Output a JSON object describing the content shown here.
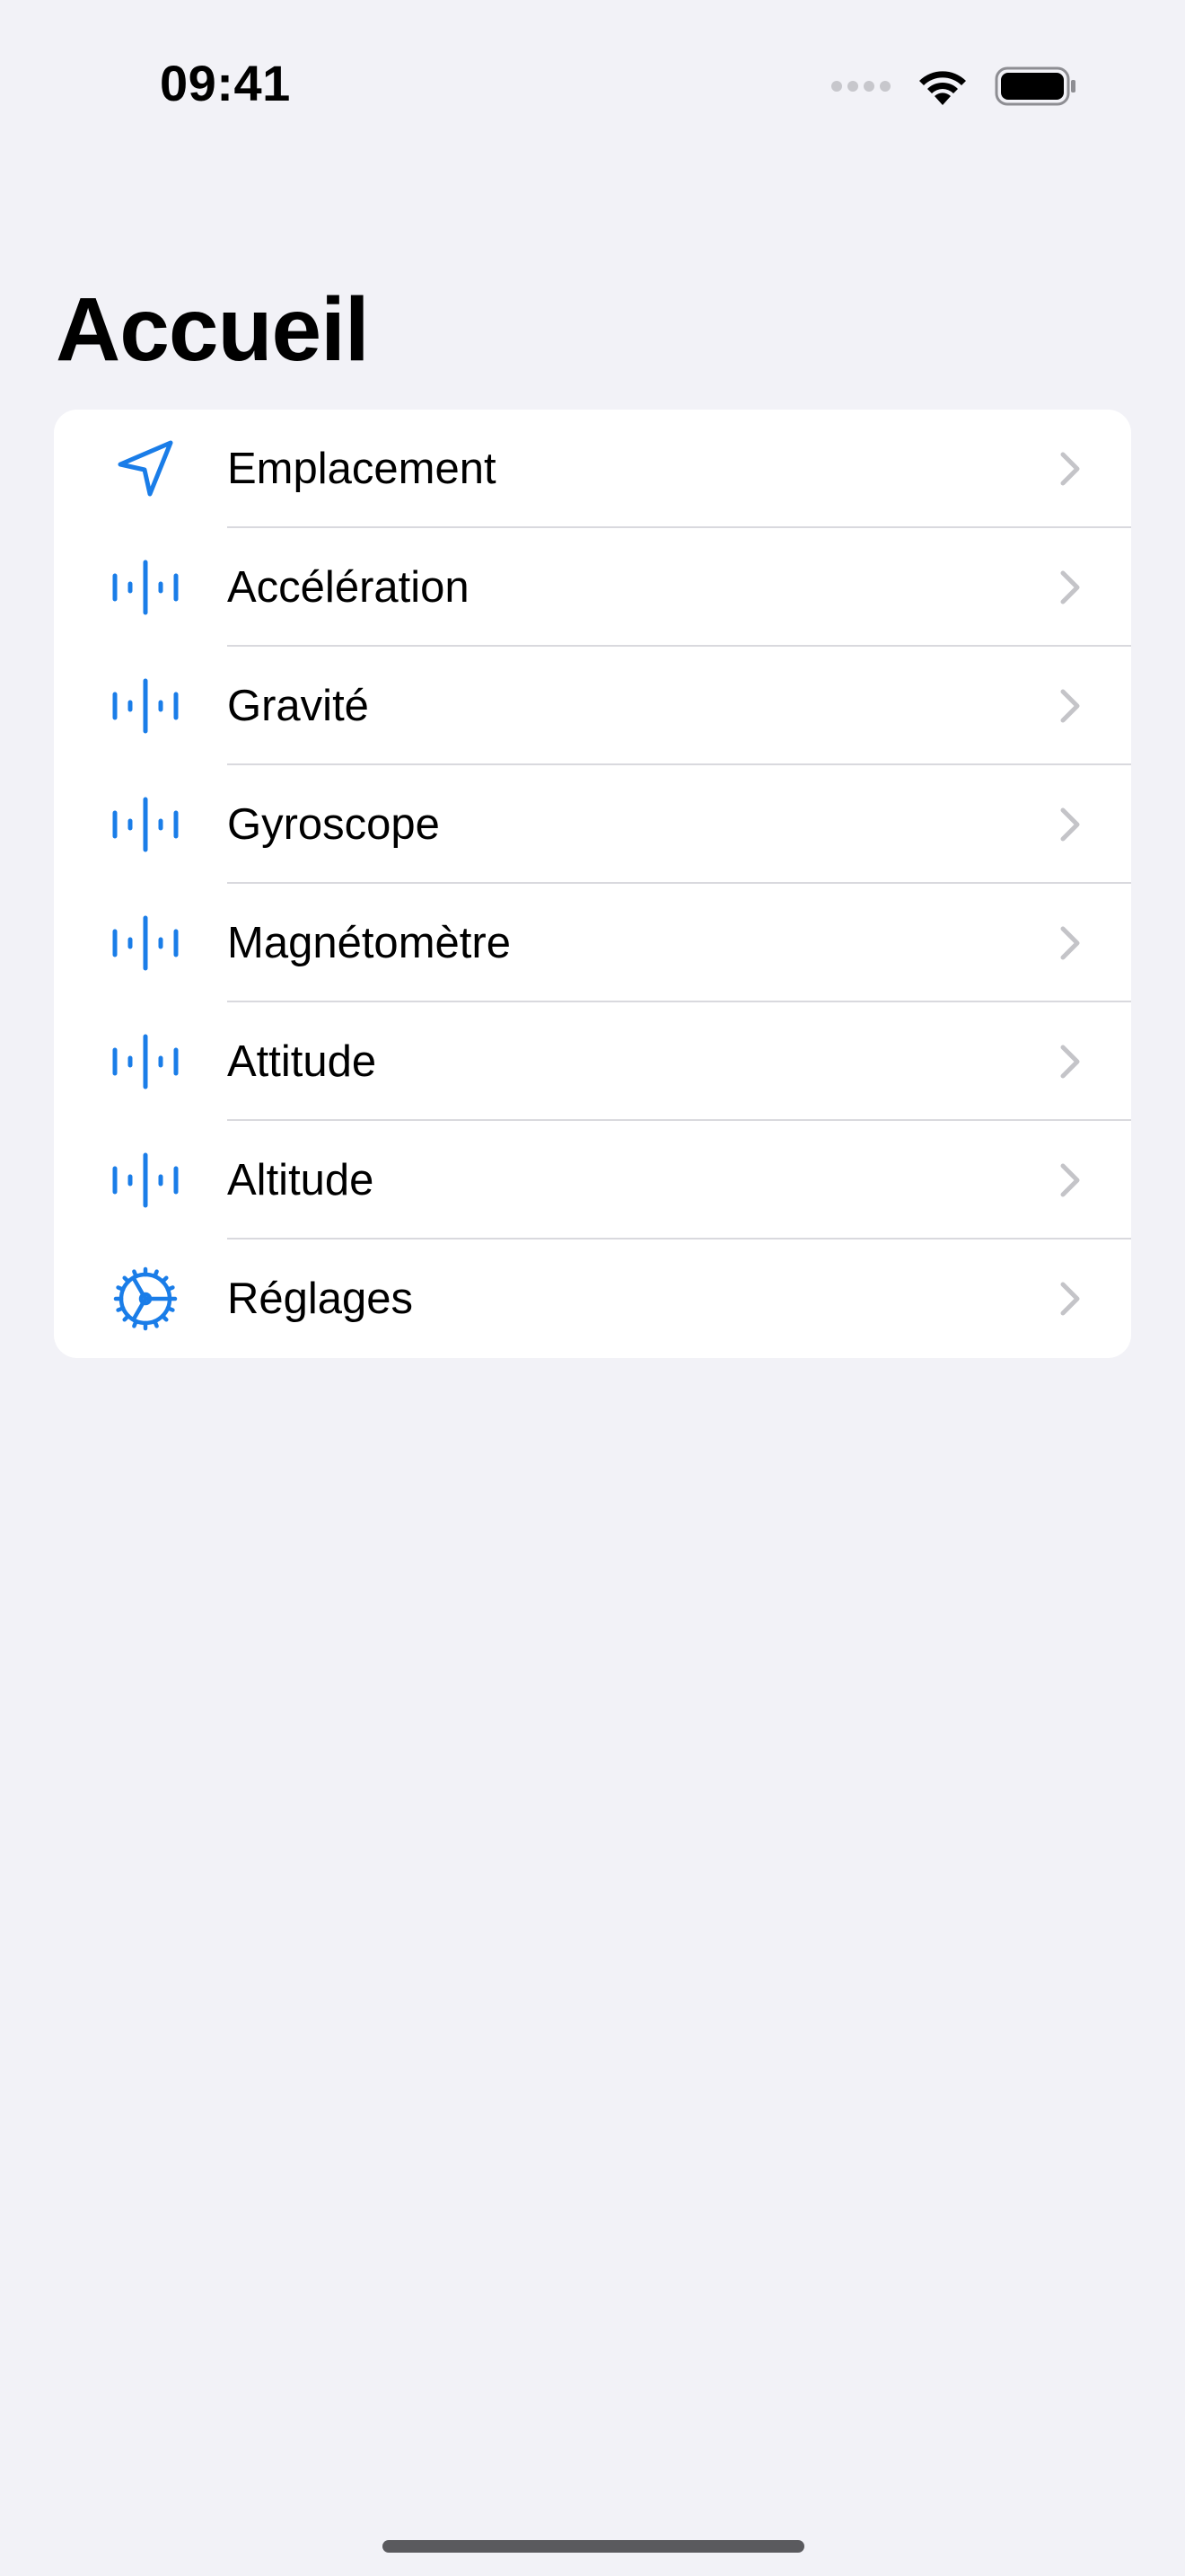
{
  "status_bar": {
    "time": "09:41"
  },
  "title": "Accueil",
  "colors": {
    "accent": "#1a7de8",
    "background": "#f2f2f7",
    "card": "#ffffff",
    "chevron": "#c4c4c8"
  },
  "menu": {
    "items": [
      {
        "label": "Emplacement",
        "icon": "location-arrow-icon"
      },
      {
        "label": "Accélération",
        "icon": "waveform-icon"
      },
      {
        "label": "Gravité",
        "icon": "waveform-icon"
      },
      {
        "label": "Gyroscope",
        "icon": "waveform-icon"
      },
      {
        "label": "Magnétomètre",
        "icon": "waveform-icon"
      },
      {
        "label": "Attitude",
        "icon": "waveform-icon"
      },
      {
        "label": "Altitude",
        "icon": "waveform-icon"
      },
      {
        "label": "Réglages",
        "icon": "gear-icon"
      }
    ]
  }
}
